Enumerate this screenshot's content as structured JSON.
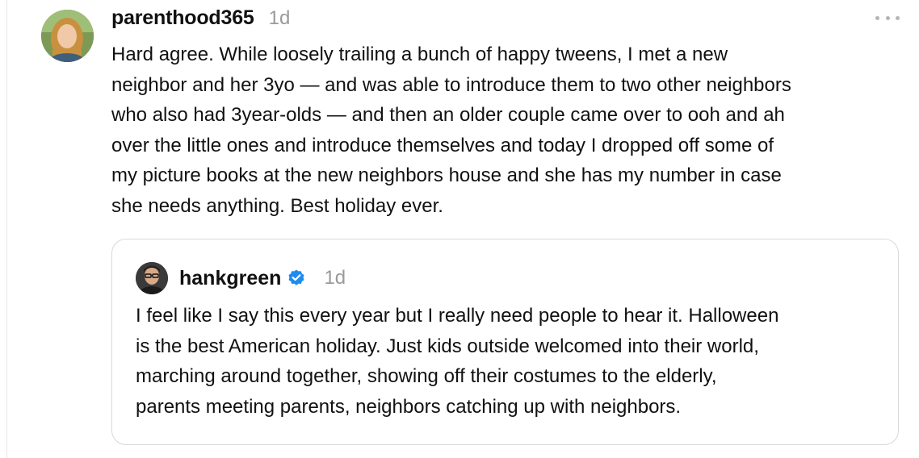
{
  "post": {
    "username": "parenthood365",
    "timestamp": "1d",
    "avatar": "avatar-photo-woman-blonde",
    "more_icon": "more-horizontal-icon",
    "body": "Hard agree. While loosely trailing a bunch of happy tweens, I met a new\nneighbor and her 3yo — and was able to introduce them to two other neighbors\nwho also had 3year-olds — and then an older couple came over to ooh and ah\nover the little ones and introduce themselves and today I dropped off some of\nmy picture books at the new neighbors house and she has my number in case\nshe needs anything. Best holiday ever."
  },
  "quoted_post": {
    "username": "hankgreen",
    "verified_icon": "verified-badge-icon",
    "timestamp": "1d",
    "avatar": "avatar-photo-man-glasses",
    "body": "I feel like I say this every year but I really need people to hear it. Halloween\nis the best American holiday. Just kids outside welcomed into their world,\nmarching around together, showing off their costumes to the elderly,\nparents meeting parents, neighbors catching up with neighbors."
  },
  "colors": {
    "text": "#111111",
    "muted": "#9a9a9a",
    "verified": "#1d8cf0",
    "card_border": "#d9d9d9"
  }
}
